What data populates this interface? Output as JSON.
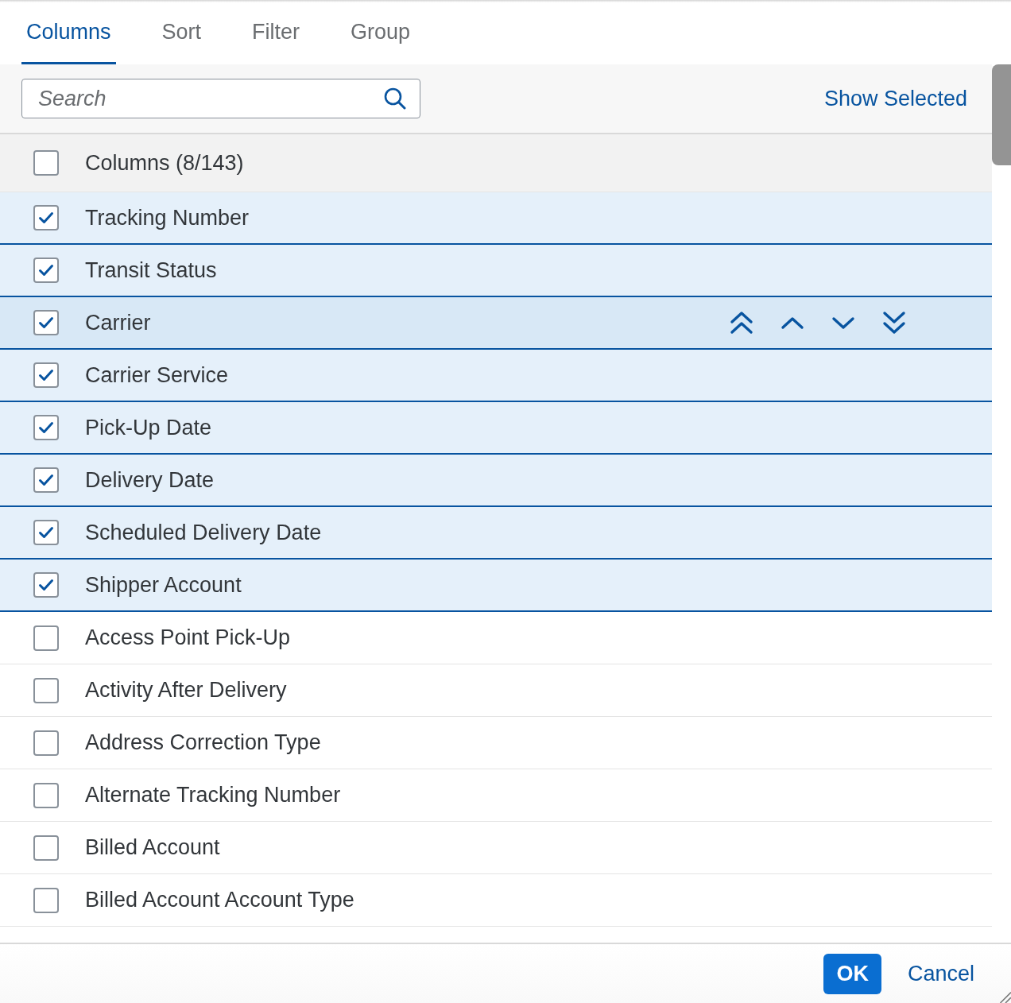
{
  "tabs": [
    {
      "label": "Columns",
      "selected": true
    },
    {
      "label": "Sort",
      "selected": false
    },
    {
      "label": "Filter",
      "selected": false
    },
    {
      "label": "Group",
      "selected": false
    }
  ],
  "toolbar": {
    "search": {
      "placeholder": "Search"
    },
    "show_selected": "Show Selected"
  },
  "list": {
    "header": {
      "label": "Columns (8/143)",
      "checked": false
    },
    "items": [
      {
        "label": "Tracking Number",
        "checked": true,
        "selected": false
      },
      {
        "label": "Transit Status",
        "checked": true,
        "selected": false
      },
      {
        "label": "Carrier",
        "checked": true,
        "selected": true
      },
      {
        "label": "Carrier Service",
        "checked": true,
        "selected": false
      },
      {
        "label": "Pick-Up Date",
        "checked": true,
        "selected": false
      },
      {
        "label": "Delivery Date",
        "checked": true,
        "selected": false
      },
      {
        "label": "Scheduled Delivery Date",
        "checked": true,
        "selected": false
      },
      {
        "label": "Shipper Account",
        "checked": true,
        "selected": false
      },
      {
        "label": "Access Point Pick-Up",
        "checked": false,
        "selected": false
      },
      {
        "label": "Activity After Delivery",
        "checked": false,
        "selected": false
      },
      {
        "label": "Address Correction Type",
        "checked": false,
        "selected": false
      },
      {
        "label": "Alternate Tracking Number",
        "checked": false,
        "selected": false
      },
      {
        "label": "Billed Account",
        "checked": false,
        "selected": false
      },
      {
        "label": "Billed Account Account Type",
        "checked": false,
        "selected": false
      }
    ]
  },
  "footer": {
    "buttons": [
      {
        "label": "OK",
        "kind": "emphasized"
      },
      {
        "label": "Cancel",
        "kind": "transparent"
      }
    ]
  }
}
